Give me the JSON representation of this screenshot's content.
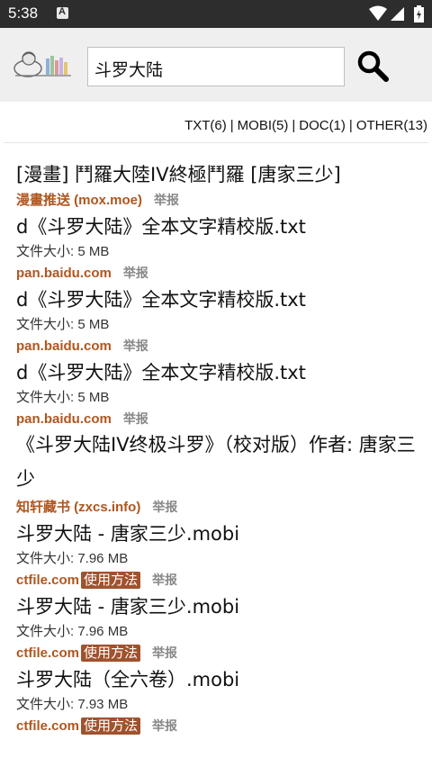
{
  "status": {
    "time": "5:38"
  },
  "search": {
    "query": "斗罗大陆"
  },
  "filters": [
    {
      "label": "TXT(6)"
    },
    {
      "label": "MOBI(5)"
    },
    {
      "label": "DOC(1)"
    },
    {
      "label": "OTHER(13)"
    }
  ],
  "results": [
    {
      "title": "[漫畫] 鬥羅大陸IV終極鬥羅 [唐家三少]",
      "size": "",
      "source": "漫畫推送 (mox.moe)",
      "howto": "",
      "report": "举报"
    },
    {
      "title": "d《斗罗大陆》全本文字精校版.txt",
      "size": "文件大小: 5 MB",
      "source": "pan.baidu.com",
      "howto": "",
      "report": "举报"
    },
    {
      "title": "d《斗罗大陆》全本文字精校版.txt",
      "size": "文件大小: 5 MB",
      "source": "pan.baidu.com",
      "howto": "",
      "report": "举报"
    },
    {
      "title": "d《斗罗大陆》全本文字精校版.txt",
      "size": "文件大小: 5 MB",
      "source": "pan.baidu.com",
      "howto": "",
      "report": "举报"
    },
    {
      "title": "《斗罗大陆IV终极斗罗》（校对版）作者: 唐家三少",
      "size": "",
      "source": "知轩藏书 (zxcs.info)",
      "howto": "",
      "report": "举报"
    },
    {
      "title": "斗罗大陆 - 唐家三少.mobi",
      "size": "文件大小: 7.96 MB",
      "source": "ctfile.com",
      "howto": "使用方法",
      "report": "举报"
    },
    {
      "title": "斗罗大陆 - 唐家三少.mobi",
      "size": "文件大小: 7.96 MB",
      "source": "ctfile.com",
      "howto": "使用方法",
      "report": "举报"
    },
    {
      "title": "斗罗大陆（全六卷）.mobi",
      "size": "文件大小: 7.93 MB",
      "source": "ctfile.com",
      "howto": "使用方法",
      "report": "举报"
    }
  ]
}
